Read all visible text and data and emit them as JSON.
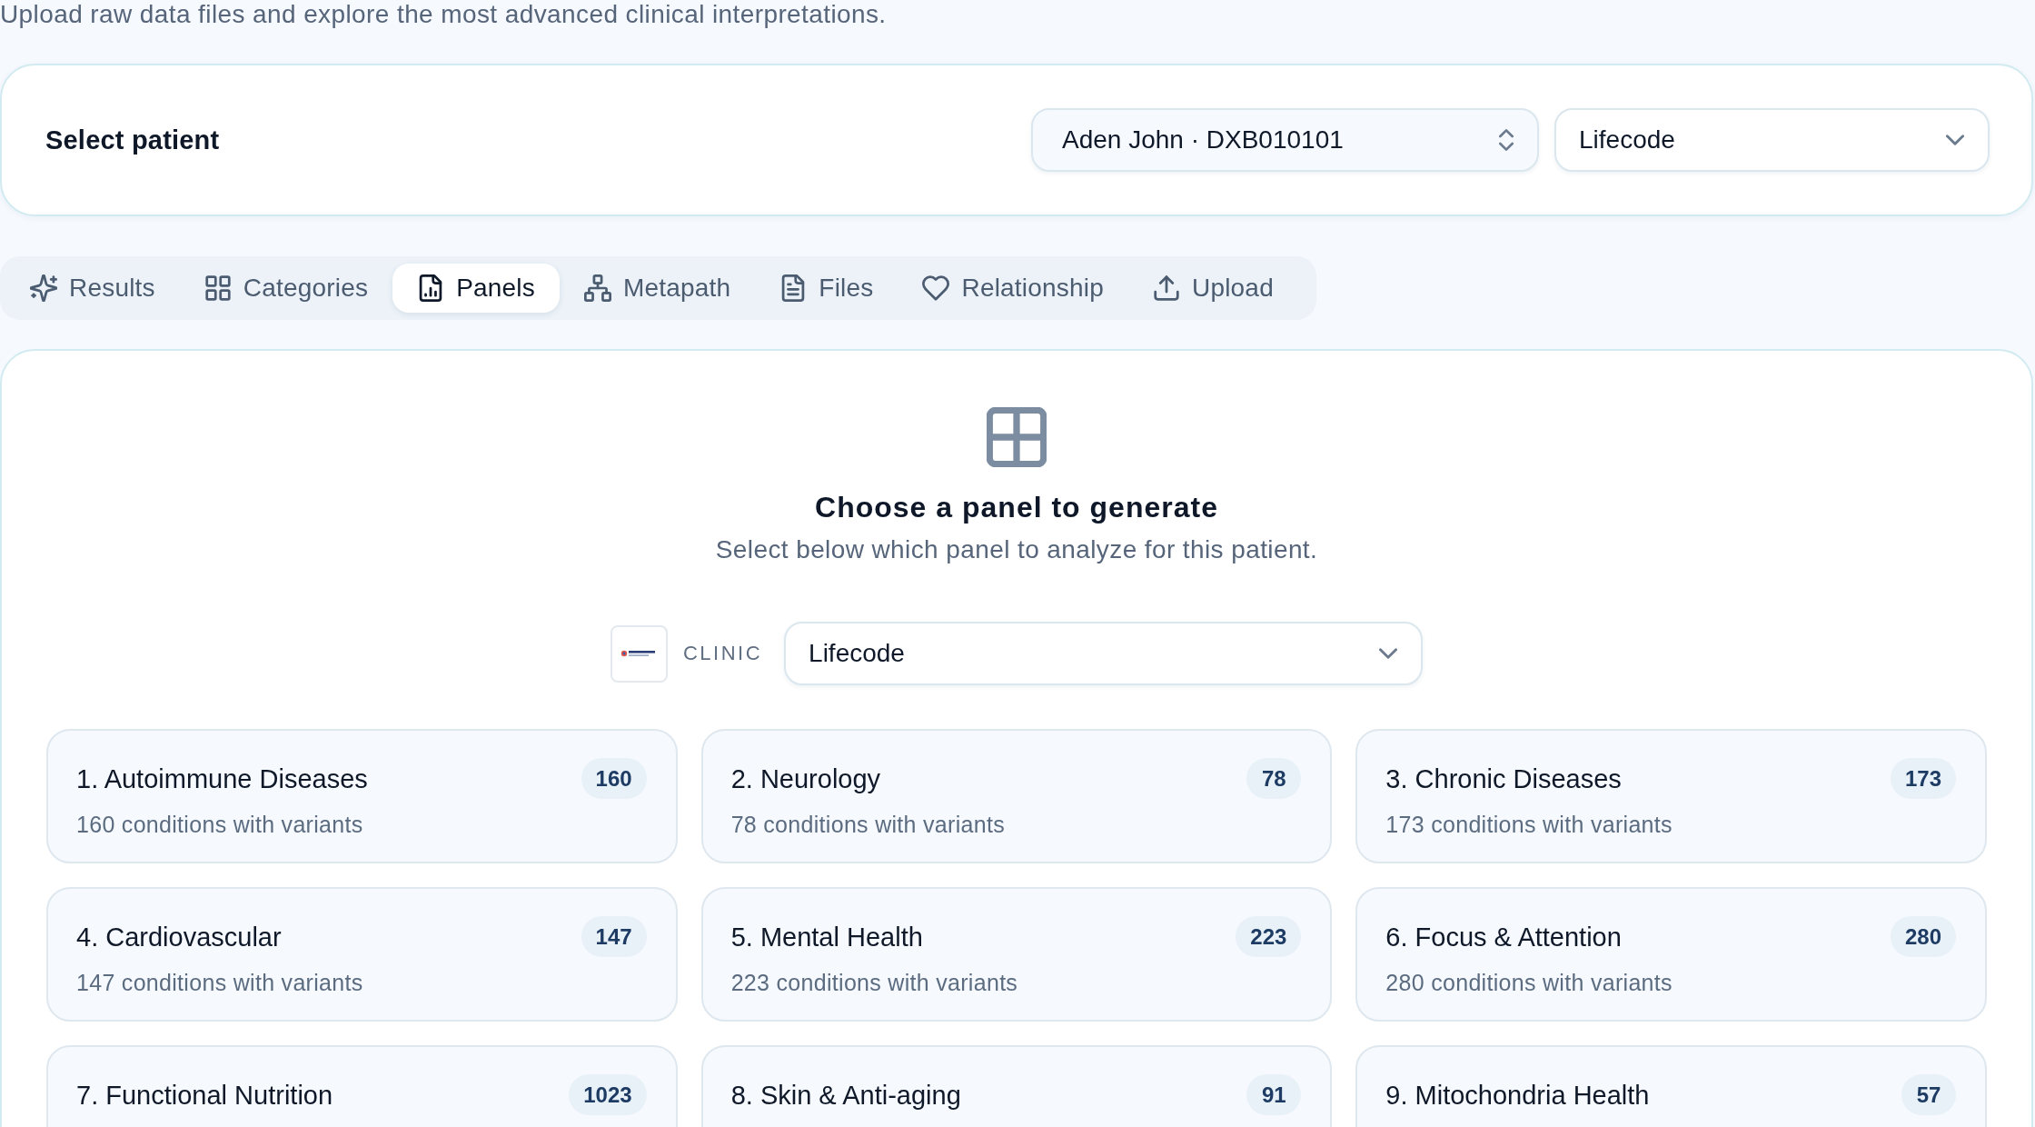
{
  "header": {
    "subtitle": "Upload raw data files and explore the most advanced clinical interpretations."
  },
  "patient_card": {
    "title": "Select patient",
    "patient_select": {
      "value": "Aden John · DXB010101"
    },
    "clinic_select": {
      "value": "Lifecode"
    }
  },
  "tabs": [
    {
      "label": "Results",
      "selected": false
    },
    {
      "label": "Categories",
      "selected": false
    },
    {
      "label": "Panels",
      "selected": true
    },
    {
      "label": "Metapath",
      "selected": false
    },
    {
      "label": "Files",
      "selected": false
    },
    {
      "label": "Relationship",
      "selected": false
    },
    {
      "label": "Upload",
      "selected": false
    }
  ],
  "panel_picker": {
    "title": "Choose a panel to generate",
    "subtitle": "Select below which panel to analyze for this patient.",
    "clinic_label": "CLINIC",
    "clinic_select": {
      "value": "Lifecode"
    },
    "panels": [
      {
        "title": "1. Autoimmune Diseases",
        "count": "160",
        "description": "160 conditions with variants"
      },
      {
        "title": "2. Neurology",
        "count": "78",
        "description": "78 conditions with variants"
      },
      {
        "title": "3. Chronic Diseases",
        "count": "173",
        "description": "173 conditions with variants"
      },
      {
        "title": "4. Cardiovascular",
        "count": "147",
        "description": "147 conditions with variants"
      },
      {
        "title": "5. Mental Health",
        "count": "223",
        "description": "223 conditions with variants"
      },
      {
        "title": "6. Focus & Attention",
        "count": "280",
        "description": "280 conditions with variants"
      },
      {
        "title": "7. Functional Nutrition",
        "count": "1023"
      },
      {
        "title": "8. Skin & Anti-aging",
        "count": "91"
      },
      {
        "title": "9. Mitochondria Health",
        "count": "57"
      }
    ]
  }
}
